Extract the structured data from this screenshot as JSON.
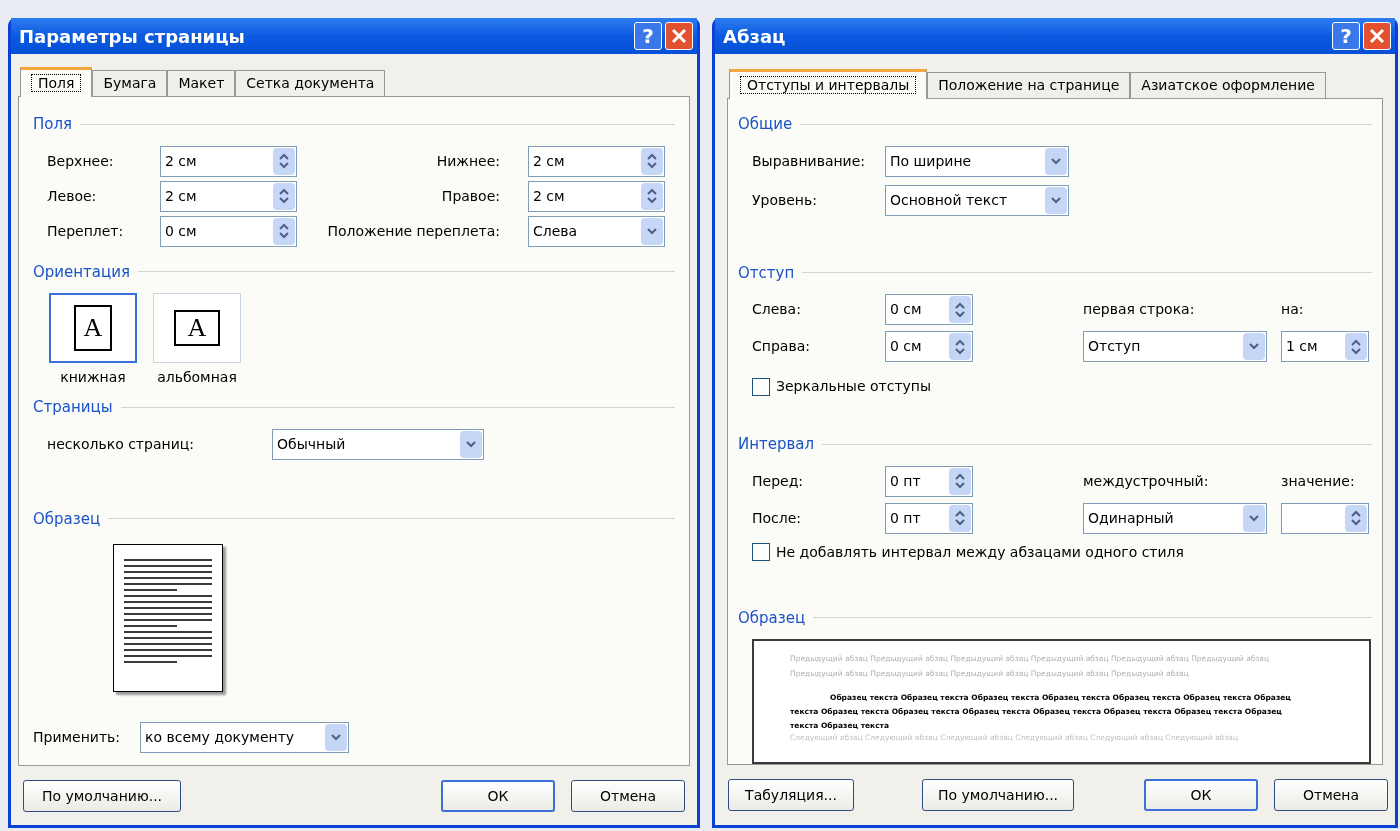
{
  "page_setup": {
    "title": "Параметры страницы",
    "help_glyph": "?",
    "tabs": [
      {
        "label": "Поля",
        "selected": true
      },
      {
        "label": "Бумага",
        "selected": false
      },
      {
        "label": "Макет",
        "selected": false
      },
      {
        "label": "Сетка документа",
        "selected": false
      }
    ],
    "margins": {
      "heading": "Поля",
      "fields": [
        {
          "label": "Верхнее:",
          "value": "2 см",
          "kind": "spin"
        },
        {
          "label": "Нижнее:",
          "value": "2 см",
          "kind": "spin"
        },
        {
          "label": "Левое:",
          "value": "2 см",
          "kind": "spin"
        },
        {
          "label": "Правое:",
          "value": "2 см",
          "kind": "spin"
        },
        {
          "label": "Переплет:",
          "value": "0 см",
          "kind": "spin"
        },
        {
          "label": "Положение переплета:",
          "value": "Слева",
          "kind": "dropdown"
        }
      ]
    },
    "orientation": {
      "heading": "Ориентация",
      "options": [
        {
          "label": "книжная",
          "glyph": "A",
          "kind": "portrait",
          "selected": true
        },
        {
          "label": "альбомная",
          "glyph": "A",
          "kind": "landscape",
          "selected": false
        }
      ]
    },
    "pages": {
      "heading": "Страницы",
      "label": "несколько страниц:",
      "value": "Обычный"
    },
    "sample": {
      "heading": "Образец"
    },
    "apply": {
      "label": "Применить:",
      "value": "ко всему документу"
    },
    "buttons": [
      {
        "label": "По умолчанию...",
        "default": false
      },
      {
        "label": "ОК",
        "default": true
      },
      {
        "label": "Отмена",
        "default": false
      }
    ]
  },
  "paragraph": {
    "title": "Абзац",
    "help_glyph": "?",
    "tabs": [
      {
        "label": "Отступы и интервалы",
        "selected": true
      },
      {
        "label": "Положение на странице",
        "selected": false
      },
      {
        "label": "Азиатское оформление",
        "selected": false
      }
    ],
    "general": {
      "heading": "Общие",
      "fields": [
        {
          "label": "Выравнивание:",
          "value": "По ширине"
        },
        {
          "label": "Уровень:",
          "value": "Основной текст"
        }
      ]
    },
    "indent": {
      "heading": "Отступ",
      "left": {
        "label": "Слева:",
        "value": "0 см"
      },
      "right": {
        "label": "Справа:",
        "value": "0 см"
      },
      "first_line": {
        "label": "первая строка:",
        "value": "Отступ"
      },
      "by": {
        "label": "на:",
        "value": "1 см"
      },
      "mirror": {
        "label": "Зеркальные отступы",
        "checked": false
      }
    },
    "spacing": {
      "heading": "Интервал",
      "before": {
        "label": "Перед:",
        "value": "0 пт"
      },
      "after": {
        "label": "После:",
        "value": "0 пт"
      },
      "line": {
        "label": "междустрочный:",
        "value": "Одинарный"
      },
      "at": {
        "label": "значение:"
      },
      "no_space": {
        "label": "Не добавлять интервал между абзацами одного стиля",
        "checked": false
      }
    },
    "preview": {
      "heading": "Образец",
      "previous": "Предыдущий абзац Предыдущий абзац Предыдущий абзац Предыдущий абзац Предыдущий абзац Предыдущий абзац Предыдущий абзац Предыдущий абзац Предыдущий абзац Предыдущий абзац Предыдущий абзац",
      "sample": "Образец текста Образец текста Образец текста Образец текста Образец текста Образец текста Образец текста Образец текста Образец текста Образец текста Образец текста Образец текста Образец текста Образец текста Образец текста",
      "next": "Следующий абзац Следующий абзац Следующий абзац Следующий абзац Следующий абзац Следующий абзац"
    },
    "buttons": [
      {
        "label": "Табуляция...",
        "default": false
      },
      {
        "label": "По умолчанию...",
        "default": false
      },
      {
        "label": "ОК",
        "default": true
      },
      {
        "label": "Отмена",
        "default": false
      }
    ]
  }
}
